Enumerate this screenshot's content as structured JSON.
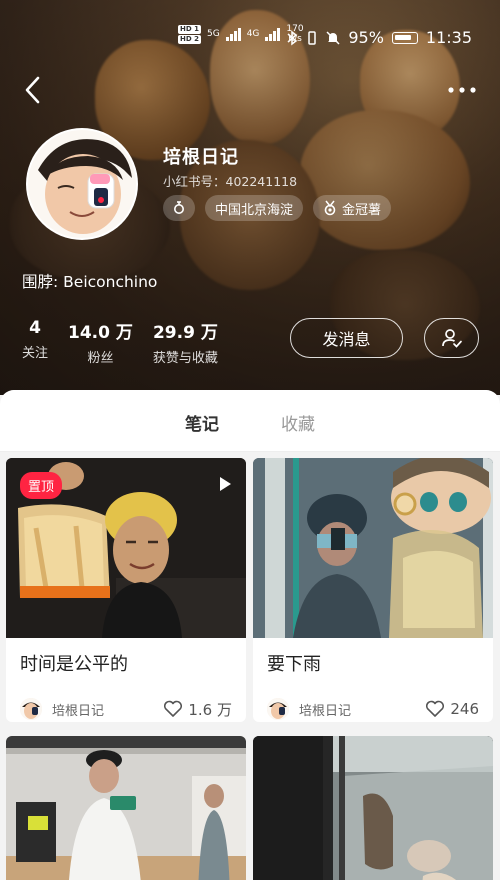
{
  "status_bar": {
    "hd1": "HD 1",
    "hd2": "HD 2",
    "net1": "5G",
    "net2": "4G",
    "speed_value": "170",
    "speed_unit": "K/s",
    "battery": "95%",
    "time": "11:35"
  },
  "profile": {
    "name": "培根日记",
    "id_label": "小红书号：402241118",
    "tags": [
      {
        "icon": "female-icon",
        "label": ""
      },
      {
        "label": "中国北京海淀"
      },
      {
        "icon": "medal-icon",
        "label": "金冠薯"
      }
    ],
    "bio": "围脖: Beiconchino",
    "stats": [
      {
        "value": "4",
        "label": "关注"
      },
      {
        "value": "14.0 万",
        "label": "粉丝"
      },
      {
        "value": "29.9 万",
        "label": "获赞与收藏"
      }
    ],
    "message_button": "发消息"
  },
  "tabs": [
    {
      "label": "笔记",
      "active": true
    },
    {
      "label": "收藏",
      "active": false
    }
  ],
  "notes": [
    {
      "title": "时间是公平的",
      "author": "培根日记",
      "likes": "1.6 万",
      "pinned_label": "置顶",
      "is_video": true
    },
    {
      "title": "要下雨",
      "author": "培根日记",
      "likes": "246"
    },
    {
      "title": "",
      "author": "",
      "likes": ""
    },
    {
      "title": "",
      "author": "",
      "likes": ""
    }
  ],
  "colors": {
    "accent": "#ff2442",
    "panel_bg": "#f3f3f3",
    "card_bg": "#ffffff"
  }
}
